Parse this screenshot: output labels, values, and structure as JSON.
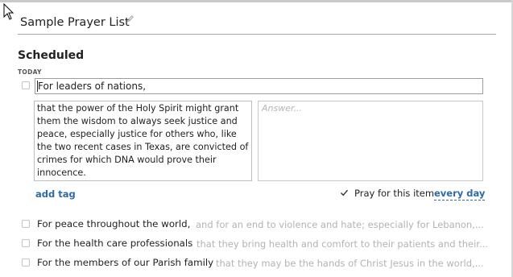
{
  "list": {
    "title": "Sample Prayer List"
  },
  "section": {
    "heading": "Scheduled",
    "day_label": "TODAY"
  },
  "active_item": {
    "title": "For leaders of nations,",
    "details": "that the power of the Holy Spirit might grant them the wisdom to always seek justice and peace, especially justice for others who, like the two recent cases in Texas, are convicted of crimes for which DNA would prove their innocence.",
    "answer_placeholder": "Answer...",
    "add_tag_label": "add tag",
    "pray_label": "Pray for this item",
    "pray_checked": true,
    "pray_frequency": "every day"
  },
  "items": [
    {
      "title": "For peace throughout the world,",
      "detail": "and for an end to violence and hate; especially for Lebanon,..."
    },
    {
      "title": "For the health care professionals",
      "detail": "that they bring health and comfort to their patients and their..."
    },
    {
      "title": "For the members of our Parish family",
      "detail": "that they may be the hands of Christ Jesus in the world,..."
    }
  ],
  "colors": {
    "link": "#2d6aa6",
    "muted_text": "#b3b3b3",
    "divider": "#a8a8a8"
  },
  "icons": {
    "edit": "pencil-icon",
    "pointer": "mouse-cursor-icon",
    "checkmark": "check-icon"
  }
}
